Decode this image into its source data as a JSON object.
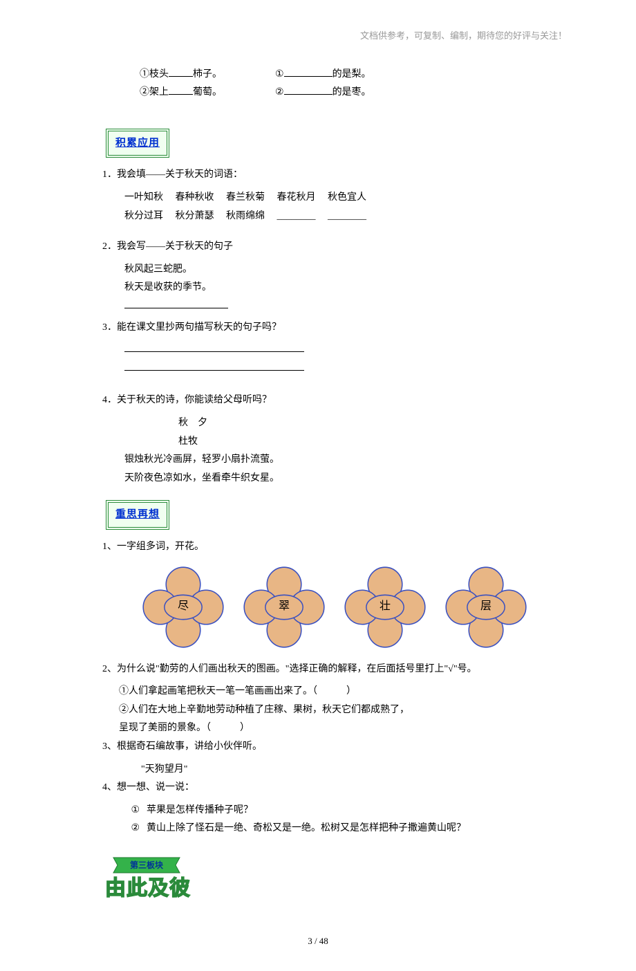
{
  "header_note": "文档供参考，可复制、编制，期待您的好评与关注！",
  "top": {
    "l1": "①枝头____柿子。",
    "l2": "②架上____葡萄。",
    "r1": "①__________的是梨。",
    "r2": "②__________的是枣。"
  },
  "sec_a": {
    "title": "积累应用"
  },
  "a1": {
    "lead": "1．我会填——关于秋天的词语：",
    "row1": [
      "一叶知秋",
      "春种秋收",
      "春兰秋菊",
      "春花秋月",
      "秋色宜人"
    ],
    "row2": [
      "秋分过耳",
      "秋分萧瑟",
      "秋雨绵绵",
      "________",
      "________"
    ]
  },
  "a2": {
    "lead": "2．我会写——关于秋天的句子",
    "line1": "秋风起三蛇肥。",
    "line2": "秋天是收获的季节。"
  },
  "a3": {
    "lead": "3．能在课文里抄两句描写秋天的句子吗？"
  },
  "a4": {
    "lead": "4．关于秋天的诗，你能读给父母听吗？",
    "title": "秋　夕",
    "author": "杜牧",
    "p1": "银烛秋光冷画屏，轻罗小扇扑流萤。",
    "p2": "天阶夜色凉如水，坐看牵牛织女星。"
  },
  "sec_b": {
    "title": "重思再想"
  },
  "b1": {
    "lead": "1、一字组多词，开花。",
    "chars": [
      "尽",
      "翠",
      "壮",
      "层"
    ]
  },
  "b2": {
    "lead": "2、为什么说\"勤劳的人们画出秋天的图画。\"选择正确的解释，在后面括号里打上\"√\"号。",
    "opt1": "①人们拿起画笔把秋天一笔一笔画画出来了。（　　　）",
    "opt2a": "②人们在大地上辛勤地劳动种植了庄稼、果树，秋天它们都成熟了，",
    "opt2b": "呈现了美丽的景象。（　　　）"
  },
  "b3": {
    "lead": "3、根据奇石编故事，讲给小伙伴听。",
    "sub": "\"天狗望月\""
  },
  "b4": {
    "lead": "4、想一想、说一说：",
    "q1n": "①",
    "q1": "苹果是怎样传播种子呢？",
    "q2n": "②",
    "q2": "黄山上除了怪石是一绝、奇松又是一绝。松树又是怎样把种子撒遍黄山呢？"
  },
  "banner": {
    "label": "第三板块",
    "title": "由此及彼"
  },
  "footer": {
    "page": "3 / 48"
  }
}
